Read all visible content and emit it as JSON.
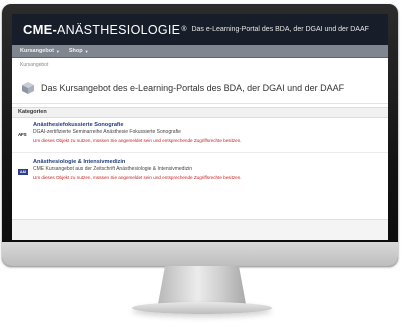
{
  "header": {
    "logo_bold": "CME-",
    "logo_rest": "ANÄSTHESIOLOGIE",
    "logo_mark": "®",
    "subtitle": "Das e-Learning-Portal des BDA, der DGAI und der DAAF"
  },
  "nav": {
    "items": [
      {
        "label": "Kursangebot",
        "caret": "▼"
      },
      {
        "label": "Shop",
        "caret": "▼"
      }
    ]
  },
  "breadcrumb": "Kursangebot",
  "page_title": "Das Kursangebot des e-Learning-Portals des BDA, der DGAI und der DAAF",
  "section_label": "Kategorien",
  "courses": [
    {
      "badge": "AFS",
      "title": "Anästhesiefokussierte Sonografie",
      "description": "DGAI-zertifizierte Seminarreihe Anästhesie Fokussierte Sonografie",
      "warning": "Um dieses Objekt zu nutzen, müssen Sie angemeldet sein und entsprechende Zugriffsrechte besitzen."
    },
    {
      "badge": "A&I",
      "title": "Anästhesiologie & Intensivmedizin",
      "description": "CME Kursangebot aus der Zeitschrift Anästhesiologie & Intensivmedizin",
      "warning": "Um dieses Objekt zu nutzen, müssen Sie angemeldet sein und entsprechende Zugriffsrechte besitzen."
    }
  ],
  "colors": {
    "header_bg": "#171e29",
    "nav_bg": "#7f8690",
    "link": "#1f3d7a",
    "warning": "#c22222"
  }
}
